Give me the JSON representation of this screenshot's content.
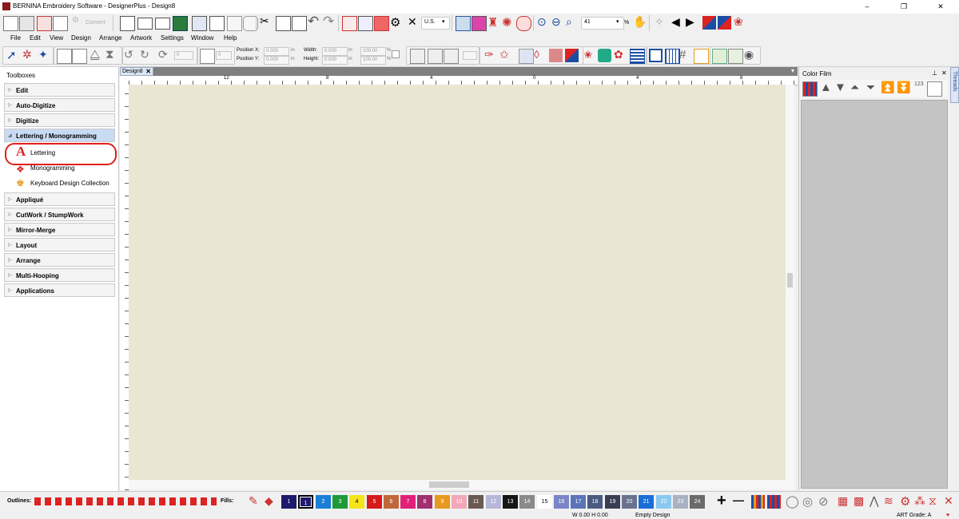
{
  "window": {
    "title": "BERNINA Embroidery Software - DesignerPlus - Design8",
    "minimize": "–",
    "restore": "❐",
    "close": "✕"
  },
  "toolbar1": {
    "convert_label": "Convert",
    "units_value": "U.S.",
    "zoom_value": "41",
    "zoom_unit": "%"
  },
  "menu": [
    "File",
    "Edit",
    "View",
    "Design",
    "Arrange",
    "Artwork",
    "Settings",
    "Window",
    "Help"
  ],
  "toolbar2": {
    "rotate_value": "0",
    "slant_value": "0",
    "position_x_label": "Position X:",
    "position_y_label": "Position Y:",
    "position_x_value": "0.000",
    "position_y_value": "0.000",
    "width_label": "Width:",
    "height_label": "Height:",
    "width_value": "0.000",
    "height_value": "0.000",
    "width_pct": "100.00",
    "height_pct": "100.00",
    "unit_in": "in",
    "unit_pct": "%"
  },
  "toolboxes": {
    "header": "Toolboxes",
    "items": [
      {
        "label": "Edit",
        "open": false
      },
      {
        "label": "Auto-Digitize",
        "open": false
      },
      {
        "label": "Digitize",
        "open": false
      },
      {
        "label": "Lettering / Monogramming",
        "open": true
      },
      {
        "label": "Appliqué",
        "open": false
      },
      {
        "label": "CutWork / StumpWork",
        "open": false
      },
      {
        "label": "Mirror-Merge",
        "open": false
      },
      {
        "label": "Layout",
        "open": false
      },
      {
        "label": "Arrange",
        "open": false
      },
      {
        "label": "Multi-Hooping",
        "open": false
      },
      {
        "label": "Applications",
        "open": false
      }
    ],
    "lettering_sub": [
      {
        "label": "Lettering",
        "icon": "lettering-a-icon"
      },
      {
        "label": "Monogramming",
        "icon": "monogram-icon"
      },
      {
        "label": "Keyboard Design Collection",
        "icon": "keyboard-collection-icon"
      }
    ]
  },
  "document": {
    "tab_label": "Design8",
    "tab_close": "✕",
    "ruler_labels": [
      "12",
      "8",
      "4",
      "0",
      "4",
      "8"
    ],
    "canvas_color": "#e9e6d4"
  },
  "color_film": {
    "title": "Color Film",
    "pin": "⊥",
    "close": "✕",
    "numbering": "123",
    "threads_tab": "Threads"
  },
  "bottom": {
    "outlines_label": "Outlines:",
    "fills_label": "Fills:",
    "swatches": [
      {
        "n": "1",
        "c": "#1e1a6e"
      },
      {
        "n": "1",
        "c": "#1e1a6e",
        "selected": true
      },
      {
        "n": "2",
        "c": "#1a7fd6"
      },
      {
        "n": "3",
        "c": "#1e9a3a"
      },
      {
        "n": "4",
        "c": "#f3e51a"
      },
      {
        "n": "5",
        "c": "#d41a1a"
      },
      {
        "n": "6",
        "c": "#c0673a"
      },
      {
        "n": "7",
        "c": "#e0207a"
      },
      {
        "n": "8",
        "c": "#a0306e"
      },
      {
        "n": "9",
        "c": "#e69a20"
      },
      {
        "n": "10",
        "c": "#f2a8b8"
      },
      {
        "n": "11",
        "c": "#6b5a52"
      },
      {
        "n": "12",
        "c": "#b6b6d8"
      },
      {
        "n": "13",
        "c": "#161616"
      },
      {
        "n": "14",
        "c": "#8a8a8a"
      },
      {
        "n": "15",
        "c": "#ffffff"
      },
      {
        "n": "16",
        "c": "#7a86c8"
      },
      {
        "n": "17",
        "c": "#5b74b8"
      },
      {
        "n": "18",
        "c": "#4a5a82"
      },
      {
        "n": "19",
        "c": "#3a3e52"
      },
      {
        "n": "20",
        "c": "#6a7290"
      },
      {
        "n": "21",
        "c": "#1a6ed6"
      },
      {
        "n": "22",
        "c": "#8ac8f0"
      },
      {
        "n": "23",
        "c": "#a8b2c4"
      },
      {
        "n": "24",
        "c": "#6a6a6a"
      }
    ],
    "add_label": "+",
    "remove_label": "—"
  },
  "status": {
    "dims": "W 0.00 H 0.00",
    "design_state": "Empty Design",
    "art_grade": "ART Grade: A"
  },
  "colors": {
    "accent_red": "#e0201a",
    "panel_blue": "#c9dbf3",
    "canvas": "#e9e6d4"
  }
}
